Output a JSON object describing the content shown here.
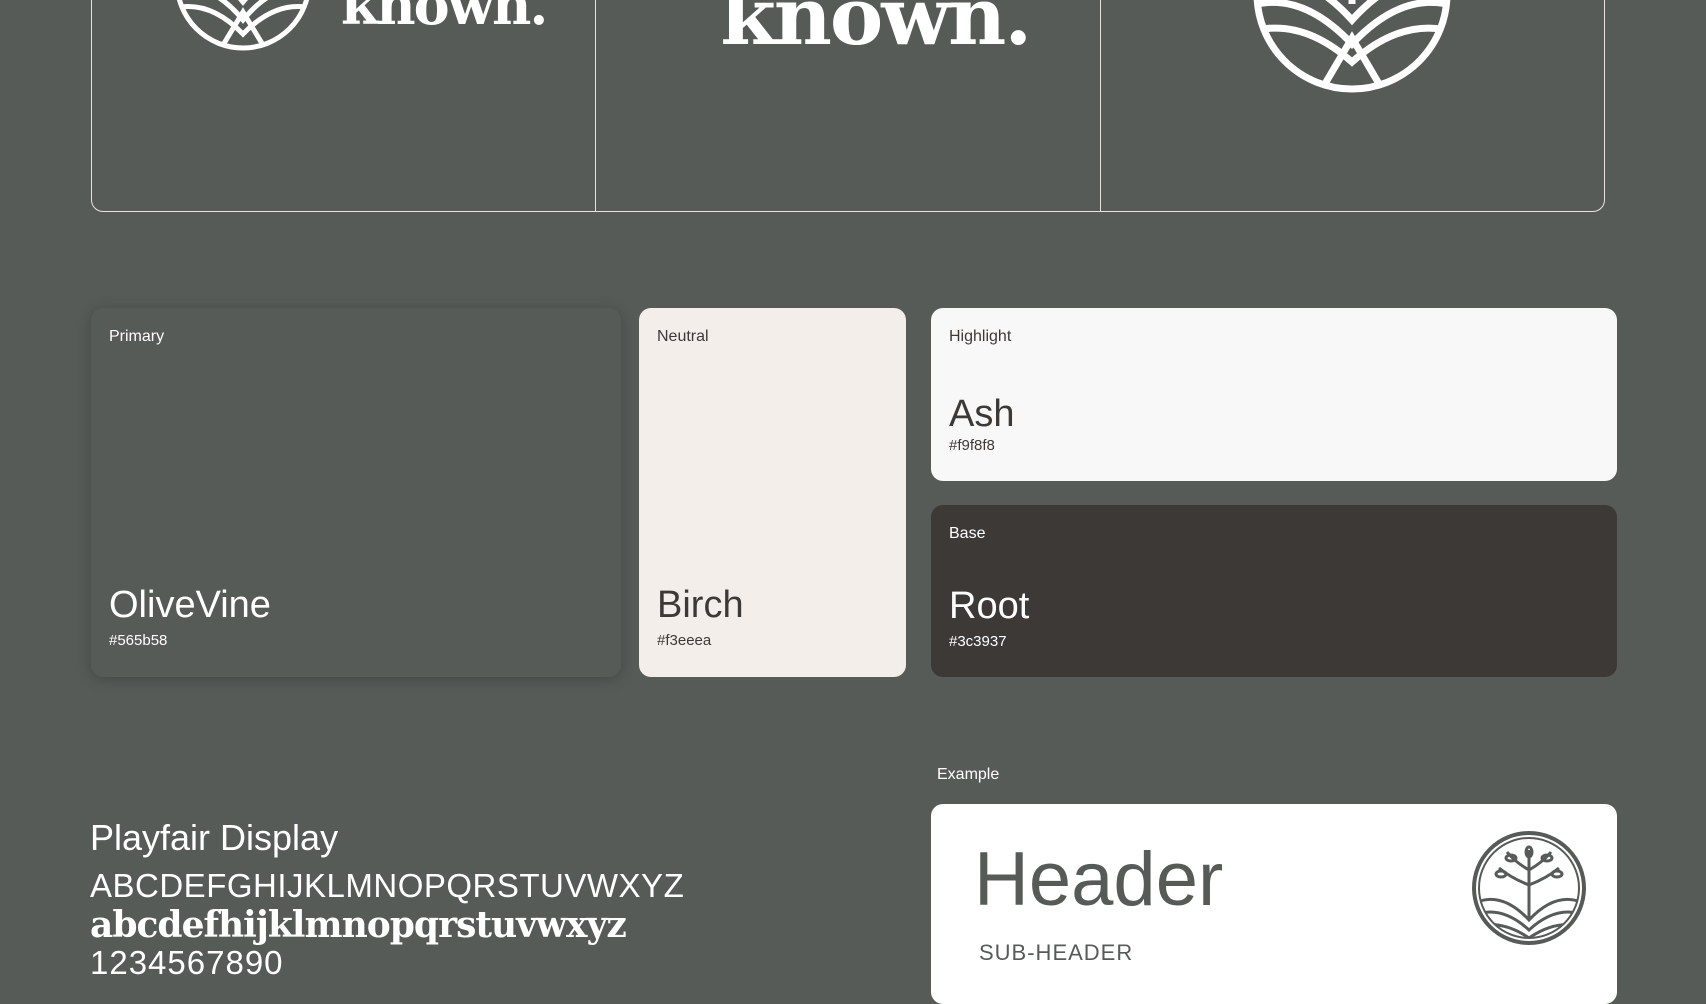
{
  "brand": {
    "wordmark": "known."
  },
  "palette": {
    "primary": {
      "tag": "Primary",
      "name": "OliveVine",
      "hex": "#565b58"
    },
    "neutral": {
      "tag": "Neutral",
      "name": "Birch",
      "hex": "#f3eeea"
    },
    "highlight": {
      "tag": "Highlight",
      "name": "Ash",
      "hex": "#f9f8f8"
    },
    "base": {
      "tag": "Base",
      "name": "Root",
      "hex": "#3c3937"
    }
  },
  "typography": {
    "font_name": "Playfair Display",
    "uppercase": "ABCDEFGHIJKLMNOPQRSTUVWXYZ",
    "lowercase": "abcdefhijklmnopqrstuvwxyz",
    "digits": "1234567890"
  },
  "example": {
    "label": "Example",
    "header": "Header",
    "subheader": "SUB-HEADER"
  },
  "icons": {
    "emblem": "tree-emblem-icon"
  }
}
